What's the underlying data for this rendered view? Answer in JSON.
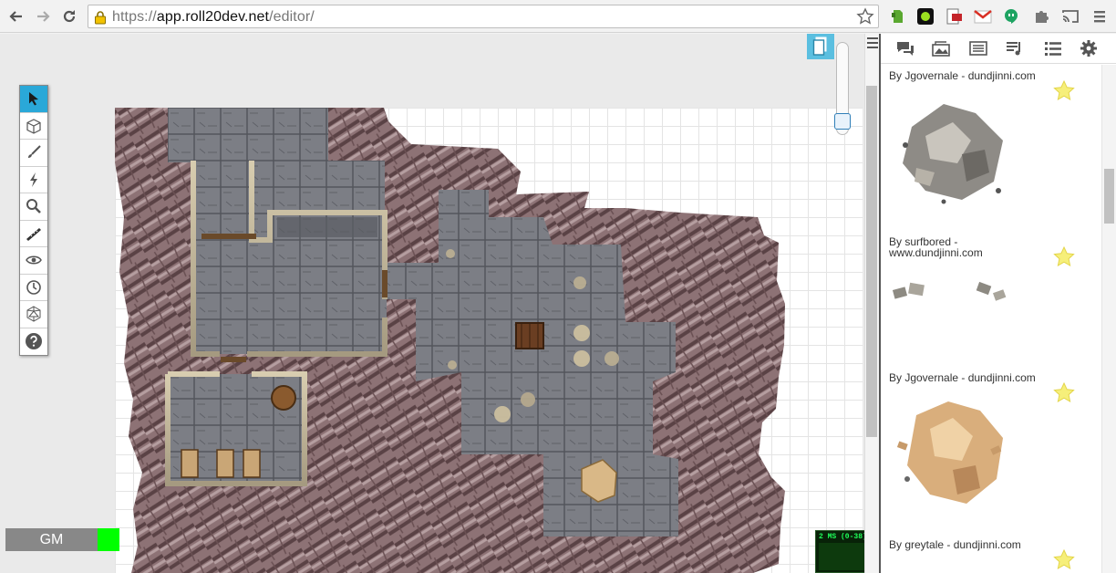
{
  "browser": {
    "url_scheme": "https://",
    "url_host": "app.roll20dev.net",
    "url_path": "/editor/",
    "icons": [
      "back-icon",
      "forward-icon",
      "reload-icon",
      "lock-icon",
      "bookmark-star-icon"
    ],
    "extensions": [
      "evernote-icon",
      "green-circle-extension-icon",
      "pdf-extension-icon",
      "gmail-icon",
      "hangouts-icon",
      "extension-puzzle-icon",
      "cast-icon",
      "chrome-menu-icon"
    ]
  },
  "toolbar": {
    "tools": [
      {
        "name": "select",
        "icon": "pointer-arrow-icon",
        "active": true
      },
      {
        "name": "layers",
        "icon": "cube-icon",
        "active": false
      },
      {
        "name": "draw",
        "icon": "brush-icon",
        "active": false
      },
      {
        "name": "ping",
        "icon": "lightning-icon",
        "active": false
      },
      {
        "name": "zoom",
        "icon": "magnifier-icon",
        "active": false
      },
      {
        "name": "measure",
        "icon": "ruler-icon",
        "active": false
      },
      {
        "name": "fog",
        "icon": "eye-icon",
        "active": false
      },
      {
        "name": "turn-tracker",
        "icon": "clock-icon",
        "active": false
      },
      {
        "name": "dice",
        "icon": "d20-icon",
        "active": false
      },
      {
        "name": "help",
        "icon": "help-icon",
        "active": false
      }
    ]
  },
  "editor": {
    "zoom_level": 0.8,
    "page_toolbar_icon": "pages-icon"
  },
  "player": {
    "name": "GM",
    "color": "#00ff00"
  },
  "perf": {
    "label": "2 MS (0-38)"
  },
  "sidebar": {
    "tabs": [
      "chat-icon",
      "art-library-icon",
      "journal-icon",
      "jukebox-icon",
      "compendium-icon",
      "settings-gear-icon"
    ],
    "art_items": [
      {
        "credit": "By Jgovernale - dundjinni.com",
        "thumb": "rubble-grey"
      },
      {
        "credit": "By surfbored - www.dundjinni.com",
        "thumb": "small-debris"
      },
      {
        "credit": "By Jgovernale - dundjinni.com",
        "thumb": "rubble-tan"
      },
      {
        "credit": "By greytale - dundjinni.com",
        "thumb": "rubble-partial"
      }
    ]
  },
  "colors": {
    "accent": "#2aa8d8",
    "rock": "#8a6e70",
    "floor": "#6e7076"
  }
}
